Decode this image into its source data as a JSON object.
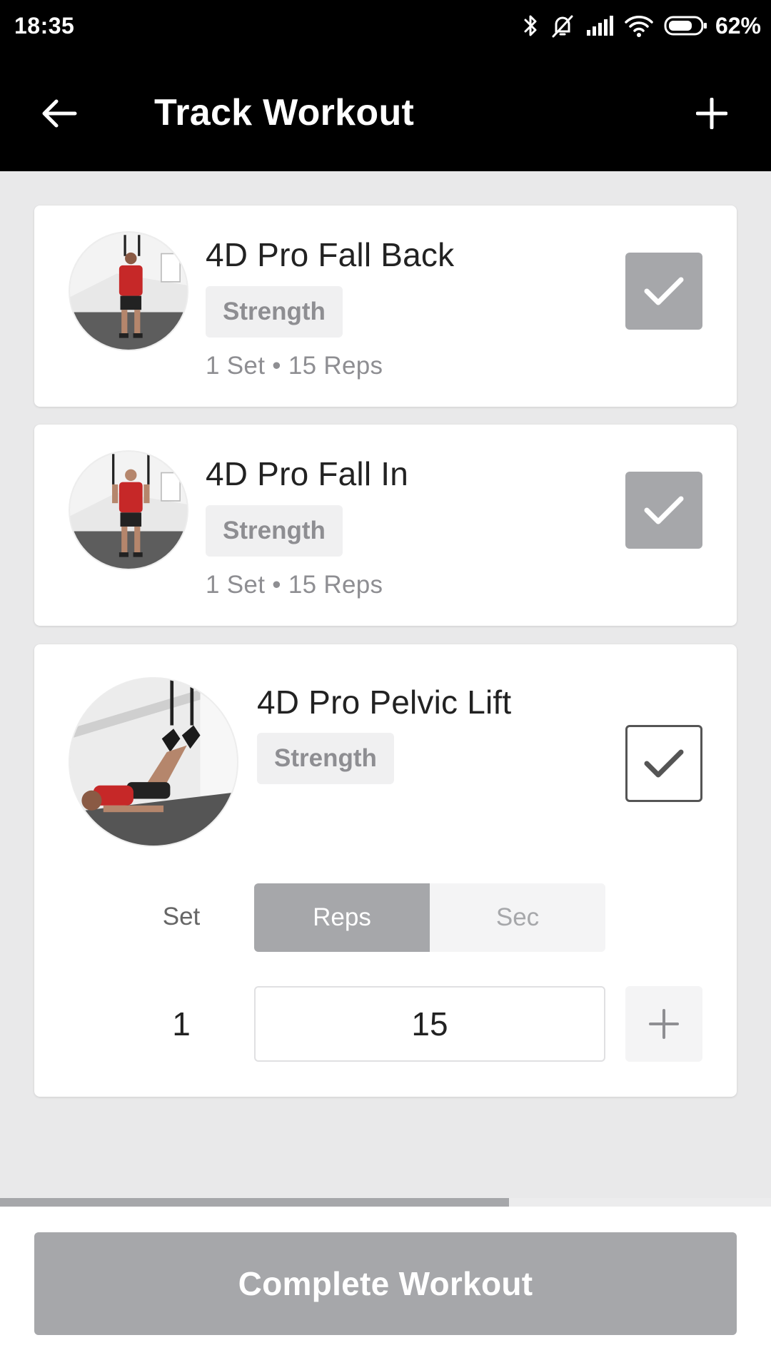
{
  "status_bar": {
    "time": "18:35",
    "battery": "62%"
  },
  "header": {
    "title": "Track Workout"
  },
  "exercises": [
    {
      "name": "4D Pro Fall Back",
      "category": "Strength",
      "summary": "1 Set • 15 Reps",
      "completed": true
    },
    {
      "name": "4D Pro Fall In",
      "category": "Strength",
      "summary": "1 Set • 15 Reps",
      "completed": true
    },
    {
      "name": "4D Pro Pelvic Lift",
      "category": "Strength",
      "completed": false,
      "editor": {
        "set_label": "Set",
        "mode_options": [
          "Reps",
          "Sec"
        ],
        "selected_mode": "Reps",
        "set_value": "1",
        "reps_value": "15"
      }
    }
  ],
  "progress": 0.66,
  "footer": {
    "complete_label": "Complete Workout"
  },
  "colors": {
    "header_bg": "#000000",
    "accent_grey": "#a6a7aa",
    "page_bg": "#e9e9ea"
  }
}
